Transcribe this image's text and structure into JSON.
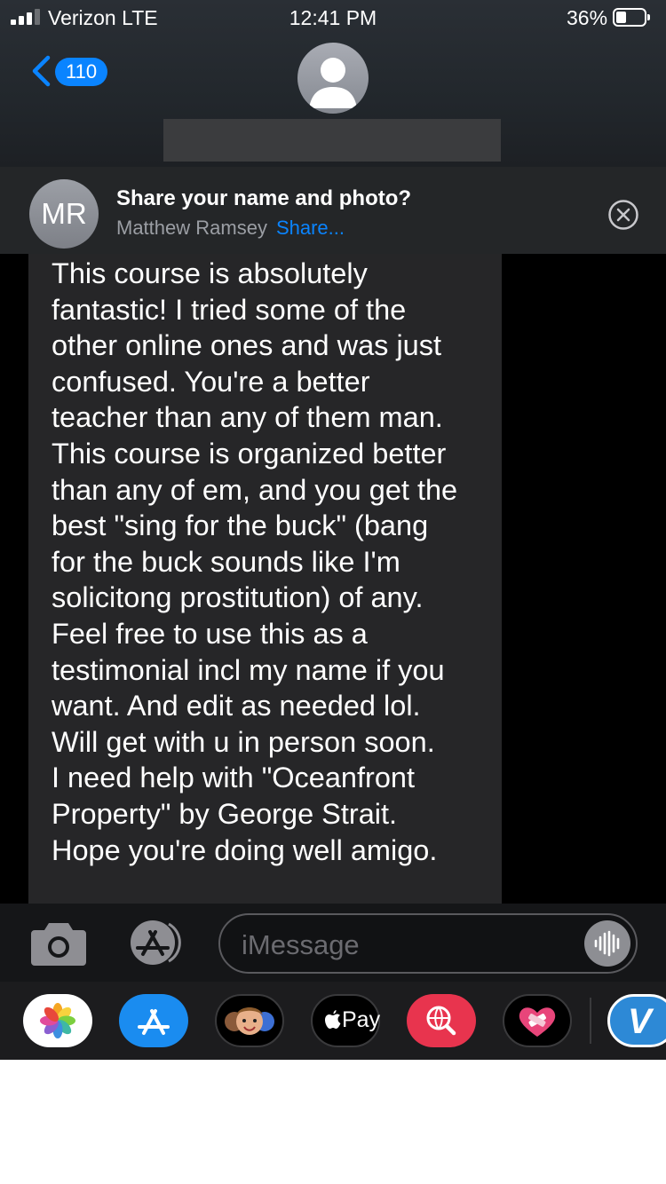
{
  "status_bar": {
    "carrier": "Verizon LTE",
    "time": "12:41 PM",
    "battery_percent": "36%",
    "battery_level": 0.36,
    "signal_bars": 3
  },
  "nav": {
    "back_count": "110"
  },
  "share_banner": {
    "initials": "MR",
    "title": "Share your name and photo?",
    "name": "Matthew Ramsey",
    "share_label": "Share..."
  },
  "message": {
    "text": "This course is absolutely\nfantastic! I tried some of the\nother online ones and was just\nconfused. You're a better\nteacher than any of them man.\nThis course is organized better\nthan any of em, and you get the\nbest \"sing for the buck\" (bang\nfor the buck sounds like I'm\nsolicitong prostitution) of any.\nFeel free to use this as a\ntestimonial incl my name if you\nwant. And edit as needed lol.\nWill get with u in person soon.\nI need help with \"Oceanfront\nProperty\" by George Strait.\nHope you're doing well amigo."
  },
  "input": {
    "placeholder": "iMessage"
  },
  "app_drawer": {
    "apps": [
      "photos-icon",
      "app-store-icon",
      "memoji-icon",
      "apple-pay-icon",
      "web-search-icon",
      "heart-sticker-icon",
      "venmo-icon"
    ],
    "apple_pay_label": "Pay",
    "venmo_label": "V"
  },
  "colors": {
    "accent": "#0a84ff",
    "bubble": "#262628",
    "background": "#000000"
  }
}
